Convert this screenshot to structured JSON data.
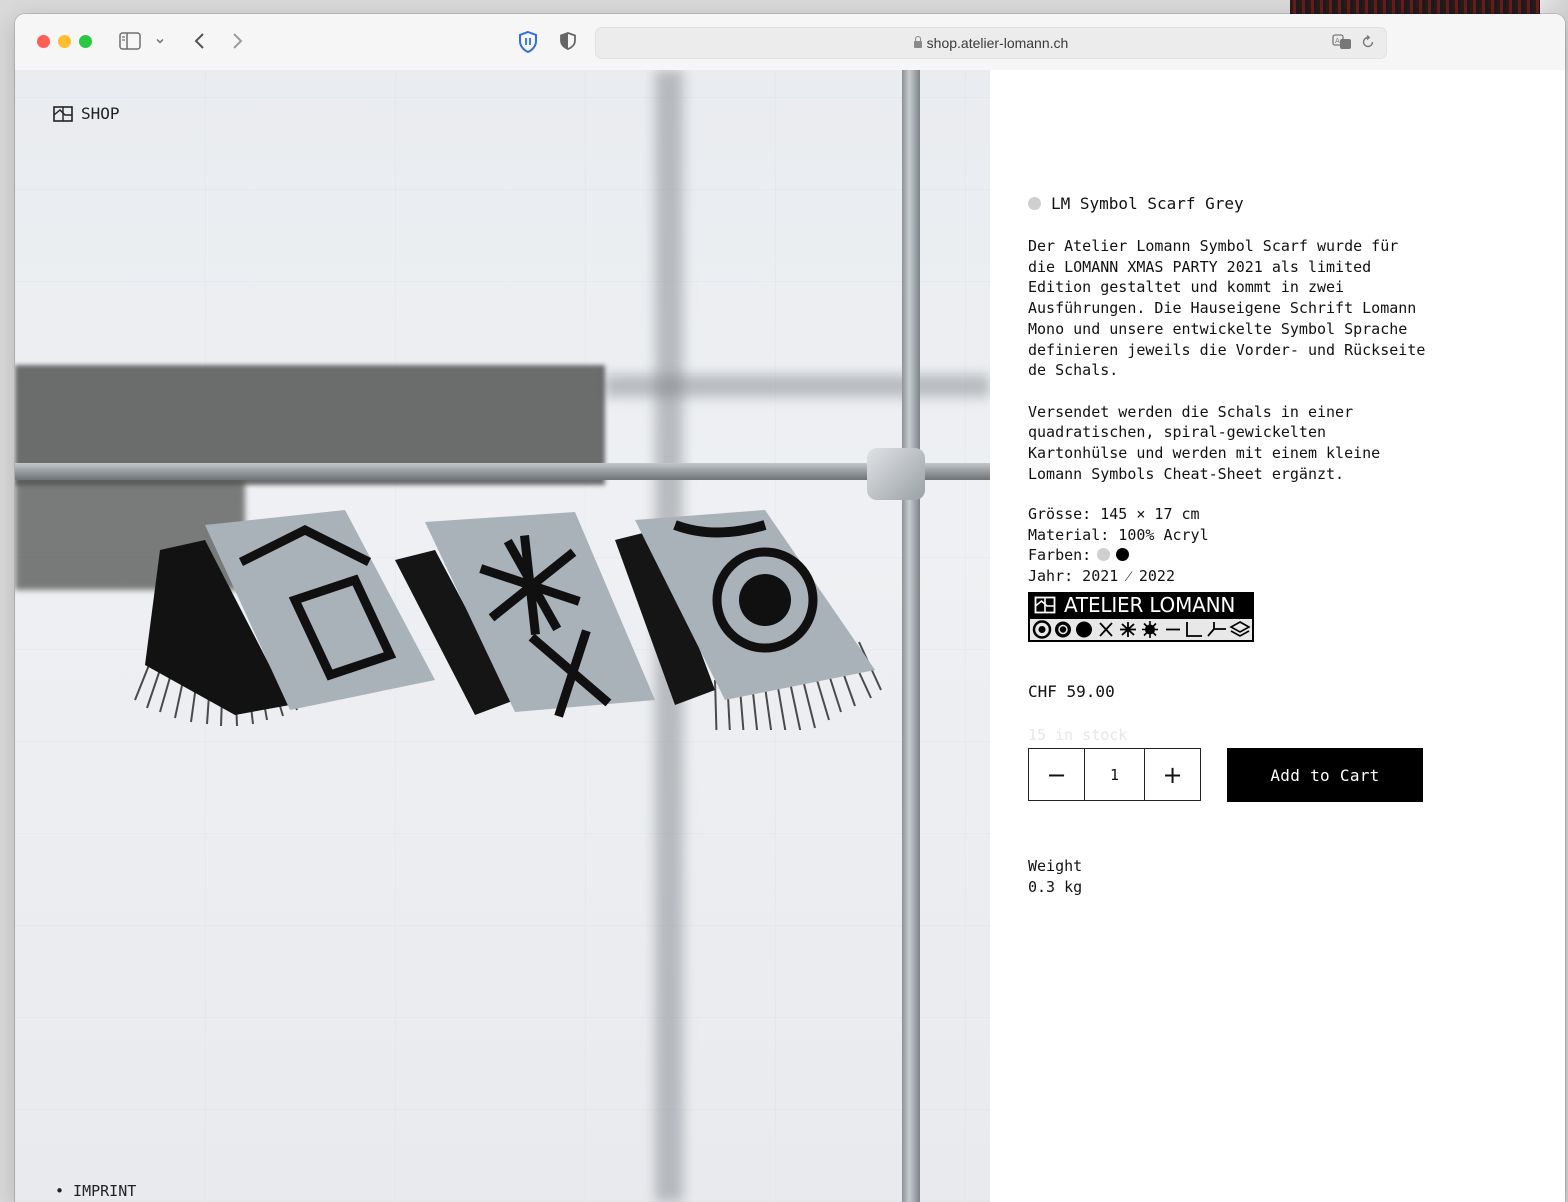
{
  "browser": {
    "url": "shop.atelier-lomann.ch"
  },
  "site": {
    "nav_label": "SHOP",
    "footer_link": "• IMPRINT"
  },
  "product": {
    "title": "LM Symbol Scarf Grey",
    "description": "Der Atelier Lomann Symbol Scarf wurde für\ndie LOMANN XMAS PARTY 2021 als limited\nEdition gestaltet und kommt in zwei\nAusführungen. Die Hauseigene Schrift Lomann\nMono und unsere entwickelte Symbol Sprache\ndefinieren jeweils die Vorder- und Rückseite\nde Schals.\n\nVersendet werden die Schals in einer\nquadratischen, spiral-gewickelten\nKartonhülse und werden mit einem kleine\nLomann Symbols Cheat-Sheet ergänzt.",
    "specs": {
      "size": "Grösse: 145 × 17 cm",
      "material": "Material: 100% Acryl",
      "colors_label": "Farben:",
      "year": "Jahr: 2021 ⁄ 2022"
    },
    "color_swatches": [
      "#cfcfcf",
      "#000000"
    ],
    "logo_text": "ATELIER LOMANN",
    "price": "CHF 59.00",
    "stock": "15 in stock",
    "quantity": "1",
    "decrement_label": "−",
    "increment_label": "+",
    "add_to_cart": "Add to Cart",
    "weight_label": "Weight",
    "weight_value": "0.3 kg"
  },
  "colors": {
    "accent": "#000000",
    "traffic_red": "#ff5f57",
    "traffic_yellow": "#febc2e",
    "traffic_green": "#28c840",
    "shield_blue": "#2f6fe0"
  },
  "icons": [
    "sidebar-icon",
    "chevron-down-icon",
    "back-icon",
    "forward-icon",
    "privacy-shield-icon",
    "half-shield-icon",
    "lock-icon",
    "translate-icon",
    "reload-icon",
    "shop-icon"
  ]
}
